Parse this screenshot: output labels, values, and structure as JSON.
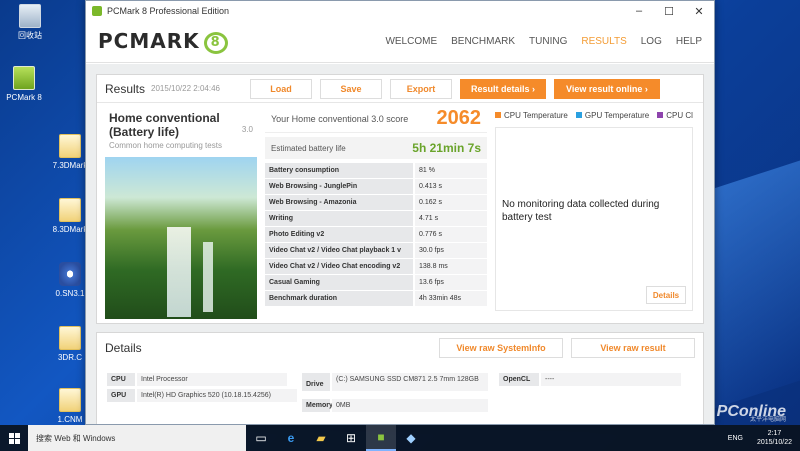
{
  "desktop": {
    "icons": [
      {
        "label": "回收站"
      },
      {
        "label": "PCMark 8"
      },
      {
        "label": "7.3DMark"
      },
      {
        "label": "8.3DMark"
      },
      {
        "label": "0.SN3.1"
      },
      {
        "label": "3DR.C"
      },
      {
        "label": "1.CNM"
      }
    ],
    "watermark": "PConline",
    "watermark_sub": "太平洋电脑网"
  },
  "window": {
    "title": "PCMark 8 Professional Edition",
    "minimize": "–",
    "maximize": "☐",
    "close": "✕"
  },
  "header": {
    "logo": "PCMARK",
    "logo_mark": "8",
    "nav": [
      "WELCOME",
      "BENCHMARK",
      "TUNING",
      "RESULTS",
      "LOG",
      "HELP"
    ],
    "active_nav": "RESULTS",
    "active_color": "#f39c35"
  },
  "results": {
    "title": "Results",
    "date": "2015/10/22 2:04:46",
    "load": "Load",
    "save": "Save",
    "export": "Export",
    "result_details": "Result details ›",
    "view_online": "View result online ›",
    "test_name": "Home conventional (Battery life)",
    "test_version": "3.0",
    "test_subtitle": "Common home computing tests",
    "score_label": "Your Home conventional 3.0 score",
    "score_value": "2062",
    "battery_label": "Estimated battery life",
    "battery_value": "5h 21min 7s",
    "metrics": [
      {
        "name": "Battery consumption",
        "value": "81 %"
      },
      {
        "name": "Web Browsing - JunglePin",
        "value": "0.413 s"
      },
      {
        "name": "Web Browsing - Amazonia",
        "value": "0.162 s"
      },
      {
        "name": "Writing",
        "value": "4.71 s"
      },
      {
        "name": "Photo Editing v2",
        "value": "0.776 s"
      },
      {
        "name": "Video Chat v2 / Video Chat playback 1 v",
        "value": "30.0 fps"
      },
      {
        "name": "Video Chat v2 / Video Chat encoding v2",
        "value": "138.8 ms"
      },
      {
        "name": "Casual Gaming",
        "value": "13.6 fps"
      },
      {
        "name": "Benchmark duration",
        "value": "4h 33min 48s"
      }
    ],
    "legend": [
      {
        "label": "CPU Temperature",
        "color": "#f58b2a"
      },
      {
        "label": "GPU Temperature",
        "color": "#2aa0e0"
      },
      {
        "label": "CPU Cl",
        "color": "#8e44ad"
      }
    ],
    "no_data": "No monitoring data collected during battery test",
    "details_btn": "Details"
  },
  "details": {
    "title": "Details",
    "view_raw_sysinfo": "View raw SystemInfo",
    "view_raw_result": "View raw result",
    "cpu_label": "CPU",
    "cpu_value": "Intel Processor",
    "gpu_label": "GPU",
    "gpu_value": "Intel(R) HD Graphics 520 (10.18.15.4256)",
    "drive_label": "Drive",
    "drive_value": "(C:) SAMSUNG SSD CM871 2.5 7mm 128GB",
    "memory_label": "Memory",
    "memory_value": "0MB",
    "opencl_label": "OpenCL",
    "opencl_value": "----"
  },
  "taskbar": {
    "search_placeholder": "搜索 Web 和 Windows",
    "lang": "ENG",
    "time": "2:17",
    "date": "2015/10/22"
  }
}
